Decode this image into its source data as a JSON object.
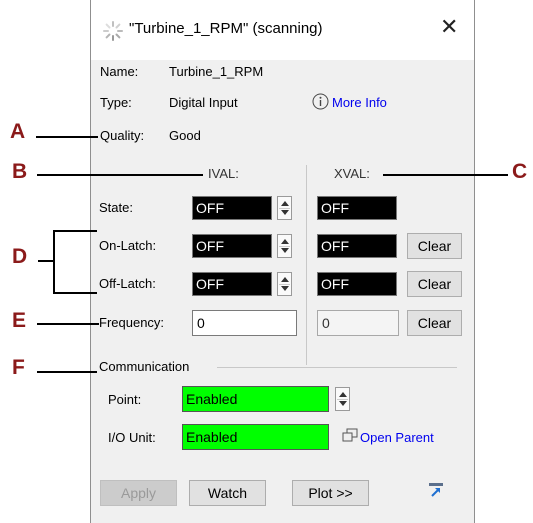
{
  "window": {
    "title": "\"Turbine_1_RPM\" (scanning)",
    "close_glyph": "✕"
  },
  "info": {
    "name_label": "Name:",
    "name_value": "Turbine_1_RPM",
    "type_label": "Type:",
    "type_value": "Digital Input",
    "more_info": "More Info",
    "quality_label": "Quality:",
    "quality_value": "Good"
  },
  "columns": {
    "ival": "IVAL:",
    "xval": "XVAL:"
  },
  "rows": {
    "state": {
      "label": "State:",
      "ival": "OFF",
      "xval": "OFF"
    },
    "on_latch": {
      "label": "On-Latch:",
      "ival": "OFF",
      "xval": "OFF",
      "clear": "Clear"
    },
    "off_latch": {
      "label": "Off-Latch:",
      "ival": "OFF",
      "xval": "OFF",
      "clear": "Clear"
    },
    "frequency": {
      "label": "Frequency:",
      "ival": "0",
      "xval": "0",
      "clear": "Clear"
    }
  },
  "communication": {
    "header": "Communication",
    "point_label": "Point:",
    "point_value": "Enabled",
    "io_label": "I/O Unit:",
    "io_value": "Enabled",
    "open_parent": "Open Parent"
  },
  "footer": {
    "apply": "Apply",
    "watch": "Watch",
    "plot": "Plot >>"
  },
  "callouts": {
    "a": "A",
    "b": "B",
    "c": "C",
    "d": "D",
    "e": "E",
    "f": "F"
  },
  "colors": {
    "enabled_green": "#00ff00",
    "value_black": "#000000",
    "callout_red": "#8b1a1a",
    "link_blue": "#0000ee"
  },
  "icons": [
    "spinner-icon",
    "close-icon",
    "info-icon",
    "open-parent-icon",
    "pin-icon"
  ]
}
